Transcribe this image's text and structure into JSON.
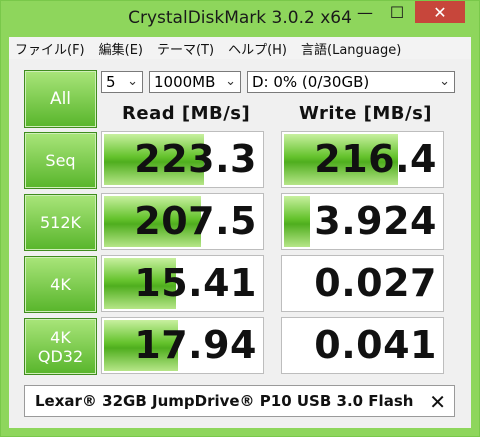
{
  "window": {
    "title": "CrystalDiskMark 3.0.2 x64",
    "minimize_glyph": "—",
    "maximize_glyph": "☐",
    "close_glyph": "✕"
  },
  "menu": [
    {
      "label": "ファイル(F)"
    },
    {
      "label": "編集(E)"
    },
    {
      "label": "テーマ(T)"
    },
    {
      "label": "ヘルプ(H)"
    },
    {
      "label": "言語(Language)"
    }
  ],
  "controls": {
    "all_label": "All",
    "count": "5",
    "size": "1000MB",
    "drive": "D: 0% (0/30GB)"
  },
  "headers": {
    "read": "Read [MB/s]",
    "write": "Write [MB/s]"
  },
  "tests": [
    {
      "label_line1": "Seq",
      "label_line2": "",
      "read": "223.3",
      "write": "216.4",
      "read_fill": 0.62,
      "write_fill": 0.71
    },
    {
      "label_line1": "512K",
      "label_line2": "",
      "read": "207.5",
      "write": "3.924",
      "read_fill": 0.6,
      "write_fill": 0.16
    },
    {
      "label_line1": "4K",
      "label_line2": "",
      "read": "15.41",
      "write": "0.027",
      "read_fill": 0.45,
      "write_fill": 0.0
    },
    {
      "label_line1": "4K",
      "label_line2": "QD32",
      "read": "17.94",
      "write": "0.041",
      "read_fill": 0.46,
      "write_fill": 0.0
    }
  ],
  "footer": {
    "device": "Lexar® 32GB JumpDrive® P10 USB 3.0 Flash",
    "close_glyph": "✕"
  },
  "colors": {
    "title_bar": "#8ed65c",
    "button_green": "#58b52b",
    "bar_green": "#64c22c",
    "close_red": "#c7463b"
  }
}
